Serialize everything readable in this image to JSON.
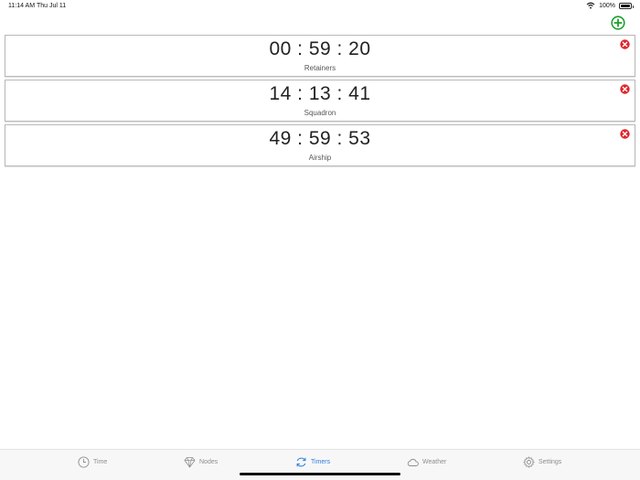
{
  "status_bar": {
    "time": "11:14 AM",
    "date": "Thu Jul 11",
    "battery": "100%",
    "battery_level": 1.0
  },
  "toolbar": {
    "add_icon": "plus-circle-icon",
    "add_color": "#1e9e2e"
  },
  "timers": [
    {
      "time": "00 : 59 : 20",
      "label": "Retainers"
    },
    {
      "time": "14 : 13 : 41",
      "label": "Squadron"
    },
    {
      "time": "49 : 59 : 53",
      "label": "Airship"
    }
  ],
  "delete_icon": "close-circle-icon",
  "delete_color": "#e0242b",
  "tab_bar": {
    "active_color": "#2f7fe0",
    "inactive_color": "#8e8e8e",
    "tabs": [
      {
        "label": "Time",
        "icon": "clock-icon"
      },
      {
        "label": "Nodes",
        "icon": "diamond-icon"
      },
      {
        "label": "Timers",
        "icon": "refresh-icon",
        "active": true
      },
      {
        "label": "Weather",
        "icon": "cloud-icon"
      },
      {
        "label": "Settings",
        "icon": "gear-icon"
      }
    ]
  }
}
